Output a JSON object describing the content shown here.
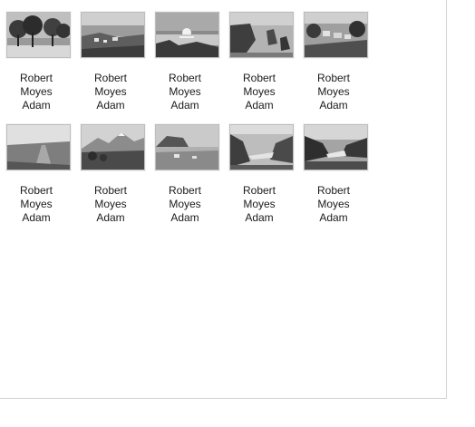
{
  "items": [
    {
      "caption": [
        "Robert",
        "Moyes",
        "Adam"
      ],
      "photo": "tree-lined-park-photo"
    },
    {
      "caption": [
        "Robert",
        "Moyes",
        "Adam"
      ],
      "photo": "coastal-village-photo"
    },
    {
      "caption": [
        "Robert",
        "Moyes",
        "Adam"
      ],
      "photo": "sunset-over-loch-photo"
    },
    {
      "caption": [
        "Robert",
        "Moyes",
        "Adam"
      ],
      "photo": "sea-cliffs-photo"
    },
    {
      "caption": [
        "Robert",
        "Moyes",
        "Adam"
      ],
      "photo": "harbour-town-photo"
    },
    {
      "caption": [
        "Robert",
        "Moyes",
        "Adam"
      ],
      "photo": "misty-moor-road-photo"
    },
    {
      "caption": [
        "Robert",
        "Moyes",
        "Adam"
      ],
      "photo": "mountain-range-photo"
    },
    {
      "caption": [
        "Robert",
        "Moyes",
        "Adam"
      ],
      "photo": "hillside-farm-photo"
    },
    {
      "caption": [
        "Robert",
        "Moyes",
        "Adam"
      ],
      "photo": "glen-with-loch-photo"
    },
    {
      "caption": [
        "Robert",
        "Moyes",
        "Adam"
      ],
      "photo": "dark-loch-valley-photo"
    }
  ]
}
